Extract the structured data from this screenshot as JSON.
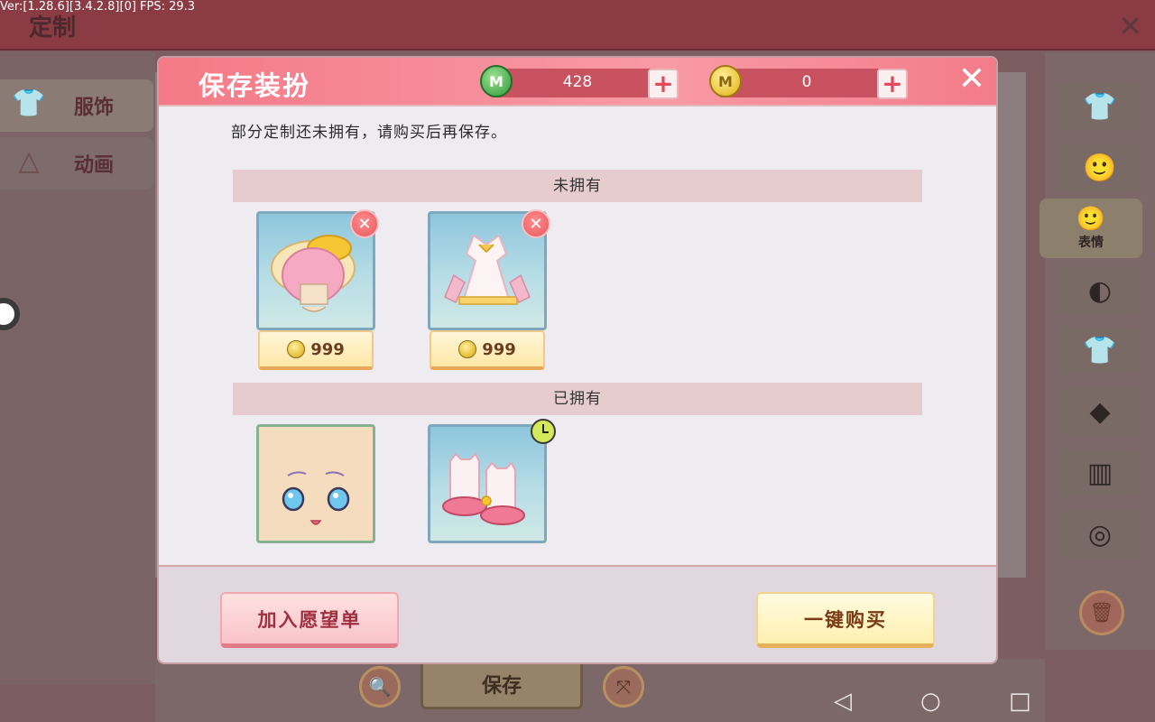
{
  "debug": {
    "version_text": "Ver:[1.28.6][3.4.2.8][0] FPS: 29.3"
  },
  "background": {
    "title": "定制",
    "left_tabs": [
      {
        "label": "服饰"
      },
      {
        "label": "动画"
      }
    ],
    "categories": [
      {
        "icon": "shirt-star-icon"
      },
      {
        "icon": "hair-face-icon"
      },
      {
        "icon": "expression-icon",
        "label": "表情",
        "active": true
      },
      {
        "icon": "mask-icon"
      },
      {
        "icon": "shirt-m-icon"
      },
      {
        "icon": "accessory-icon"
      },
      {
        "icon": "pants-icon"
      },
      {
        "icon": "shoes-icon"
      }
    ],
    "save_label": "保存"
  },
  "modal": {
    "title": "保存装扮",
    "currencies": [
      {
        "type": "gem",
        "symbol": "M",
        "value": "428",
        "color": "#2f9a3a"
      },
      {
        "type": "coin",
        "symbol": "M",
        "value": "0",
        "color": "#e2b012"
      }
    ],
    "message": "部分定制还未拥有，请购买后再保存。",
    "sections": {
      "not_owned": {
        "label": "未拥有",
        "items": [
          {
            "name": "pink-hair-yellow-hat",
            "price": "999"
          },
          {
            "name": "white-ribbon-dress",
            "price": "999"
          }
        ]
      },
      "owned": {
        "label": "已拥有",
        "items": [
          {
            "name": "anime-face"
          },
          {
            "name": "cat-boots",
            "timed": true
          }
        ]
      }
    },
    "buttons": {
      "wishlist": "加入愿望单",
      "buy_all": "一键购买"
    }
  },
  "system_nav": {
    "back": "◁",
    "home": "○",
    "recents": "□"
  }
}
